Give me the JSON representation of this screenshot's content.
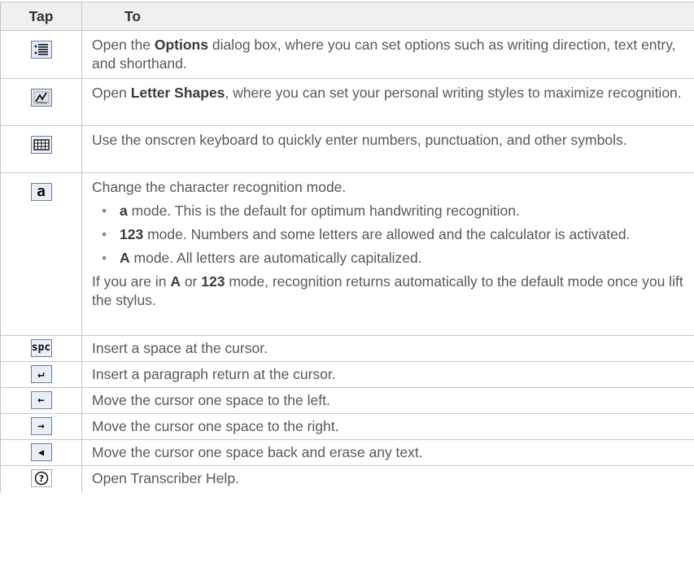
{
  "header": {
    "tap": "Tap",
    "to": "To"
  },
  "rows": [
    {
      "icon": "options-icon",
      "pre": "Open the ",
      "bold": "Options",
      "post": " dialog box, where you can set options such as writing direction, text entry, and shorthand."
    },
    {
      "icon": "letter-shapes-icon",
      "pre": "Open ",
      "bold": "Letter Shapes",
      "post": ", where you can set your personal writing styles to maximize recognition."
    },
    {
      "icon": "keyboard-icon",
      "text": "Use the onscren keyboard to quickly enter numbers, punctuation, and other symbols."
    },
    {
      "icon": "recognition-mode-icon",
      "icon_glyph": "a",
      "intro": "Change the character recognition mode.",
      "bullets": [
        {
          "bold": "a",
          "text": " mode. This is the default for optimum handwriting recognition."
        },
        {
          "bold": "123",
          "text": " mode. Numbers and some letters are allowed and the calculator is activated."
        },
        {
          "bold": "A",
          "text": " mode. All letters are automatically capitalized."
        }
      ],
      "outro_1": "If you are in ",
      "outro_b1": "A",
      "outro_2": " or ",
      "outro_b2": "123",
      "outro_3": " mode, recognition returns automatically to the default mode once you lift the stylus."
    },
    {
      "icon": "space-icon",
      "icon_glyph": "spc",
      "text": "Insert a space at the cursor."
    },
    {
      "icon": "return-icon",
      "icon_glyph": "↵",
      "text": "Insert a paragraph return at the cursor."
    },
    {
      "icon": "left-arrow-icon",
      "icon_glyph": "←",
      "text": "Move the cursor one space to the left."
    },
    {
      "icon": "right-arrow-icon",
      "icon_glyph": "→",
      "text": "Move the cursor one space to the right."
    },
    {
      "icon": "backspace-icon",
      "icon_glyph": "◀",
      "text": "Move the cursor one space back and erase any text."
    },
    {
      "icon": "help-icon",
      "icon_glyph": "?",
      "text": "Open Transcriber Help."
    }
  ]
}
